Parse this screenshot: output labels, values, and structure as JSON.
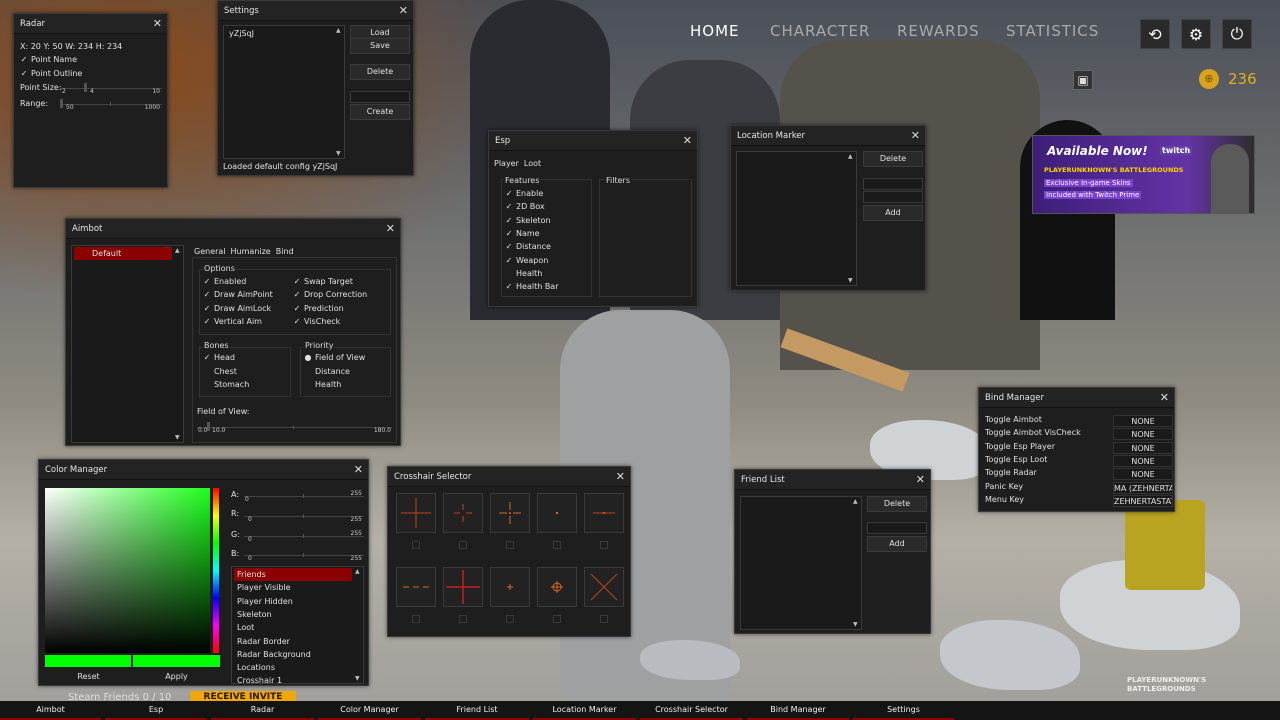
{
  "topnav": {
    "home": "HOME",
    "character": "CHARACTER",
    "rewards": "REWARDS",
    "statistics": "STATISTICS",
    "coins": "236"
  },
  "ad": {
    "line1": "Available Now!",
    "line2": "PLAYERUNKNOWN'S BATTLEGROUNDS",
    "line3": "Exclusive In-game Skins",
    "line4": "Included with Twitch Prime",
    "brand": "twitch"
  },
  "radar": {
    "title": "Radar",
    "info": "X: 20 Y: 50 W: 234 H: 234",
    "point_name": "Point Name",
    "point_outline": "Point Outline",
    "point_size": "Point Size:",
    "ps_min": "2",
    "ps_val": "4",
    "ps_max": "10",
    "range": "Range:",
    "r_val": "50",
    "r_max": "1000"
  },
  "settings": {
    "title": "Settings",
    "config": "yZjSqJ",
    "load": "Load",
    "save": "Save",
    "delete": "Delete",
    "create": "Create",
    "status": "Loaded default config yZjSqJ"
  },
  "esp": {
    "title": "Esp",
    "tab_player": "Player",
    "tab_loot": "Loot",
    "features": "Features",
    "filters": "Filters",
    "items": [
      {
        "label": "Enable",
        "checked": true
      },
      {
        "label": "2D Box",
        "checked": true
      },
      {
        "label": "Skeleton",
        "checked": true
      },
      {
        "label": "Name",
        "checked": true
      },
      {
        "label": "Distance",
        "checked": true
      },
      {
        "label": "Weapon",
        "checked": true
      },
      {
        "label": "Health",
        "checked": false
      },
      {
        "label": "Health Bar",
        "checked": true
      }
    ]
  },
  "location": {
    "title": "Location Marker",
    "delete": "Delete",
    "add": "Add"
  },
  "aimbot": {
    "title": "Aimbot",
    "profile": "Default",
    "tab_general": "General",
    "tab_humanize": "Humanize",
    "tab_bind": "Bind",
    "options": "Options",
    "opts_left": [
      {
        "label": "Enabled",
        "checked": true
      },
      {
        "label": "Draw AimPoint",
        "checked": true
      },
      {
        "label": "Draw AimLock",
        "checked": true
      },
      {
        "label": "Vertical Aim",
        "checked": true
      }
    ],
    "opts_right": [
      {
        "label": "Swap Target",
        "checked": true
      },
      {
        "label": "Drop Correction",
        "checked": true
      },
      {
        "label": "Prediction",
        "checked": true
      },
      {
        "label": "VisCheck",
        "checked": true
      }
    ],
    "bones": "Bones",
    "bone_items": [
      {
        "label": "Head",
        "checked": true
      },
      {
        "label": "Chest",
        "checked": false
      },
      {
        "label": "Stomach",
        "checked": false
      }
    ],
    "priority": "Priority",
    "prio_items": [
      {
        "label": "Field of View",
        "selected": true
      },
      {
        "label": "Distance",
        "selected": false
      },
      {
        "label": "Health",
        "selected": false
      }
    ],
    "fov": "Field of View:",
    "fov_min": "0.0",
    "fov_val": "10.0",
    "fov_max": "180.0"
  },
  "color": {
    "title": "Color Manager",
    "a": "A:",
    "r": "R:",
    "g": "G:",
    "b": "B:",
    "ch_min": "0",
    "ch_max": "255",
    "reset": "Reset",
    "apply": "Apply",
    "accent": "#00ff00",
    "items": [
      "Friends",
      "Player Visible",
      "Player Hidden",
      "Skeleton",
      "Loot",
      "Radar Border",
      "Radar Background",
      "Locations",
      "Crosshair 1"
    ]
  },
  "crosshair": {
    "title": "Crosshair Selector"
  },
  "friend": {
    "title": "Friend List",
    "delete": "Delete",
    "add": "Add"
  },
  "bind": {
    "title": "Bind Manager",
    "rows": [
      {
        "k": "Toggle Aimbot",
        "v": "NONE"
      },
      {
        "k": "Toggle Aimbot VisCheck",
        "v": "NONE"
      },
      {
        "k": "Toggle Esp Player",
        "v": "NONE"
      },
      {
        "k": "Toggle Esp Loot",
        "v": "NONE"
      },
      {
        "k": "Toggle Radar",
        "v": "NONE"
      },
      {
        "k": "Panic Key",
        "v": "MA (ZEHNERTAST"
      },
      {
        "k": "Menu Key",
        "v": "ZEHNERTASTATU"
      }
    ]
  },
  "taskbar": [
    "Aimbot",
    "Esp",
    "Radar",
    "Color Manager",
    "Friend List",
    "Location Marker",
    "Crosshair Selector",
    "Bind Manager",
    "Settings"
  ],
  "game": {
    "friends": "Steam Friends 0 / 10",
    "invite": "RECEIVE INVITE",
    "logo": "PLAYERUNKNOWN'S BATTLEGROUNDS"
  }
}
